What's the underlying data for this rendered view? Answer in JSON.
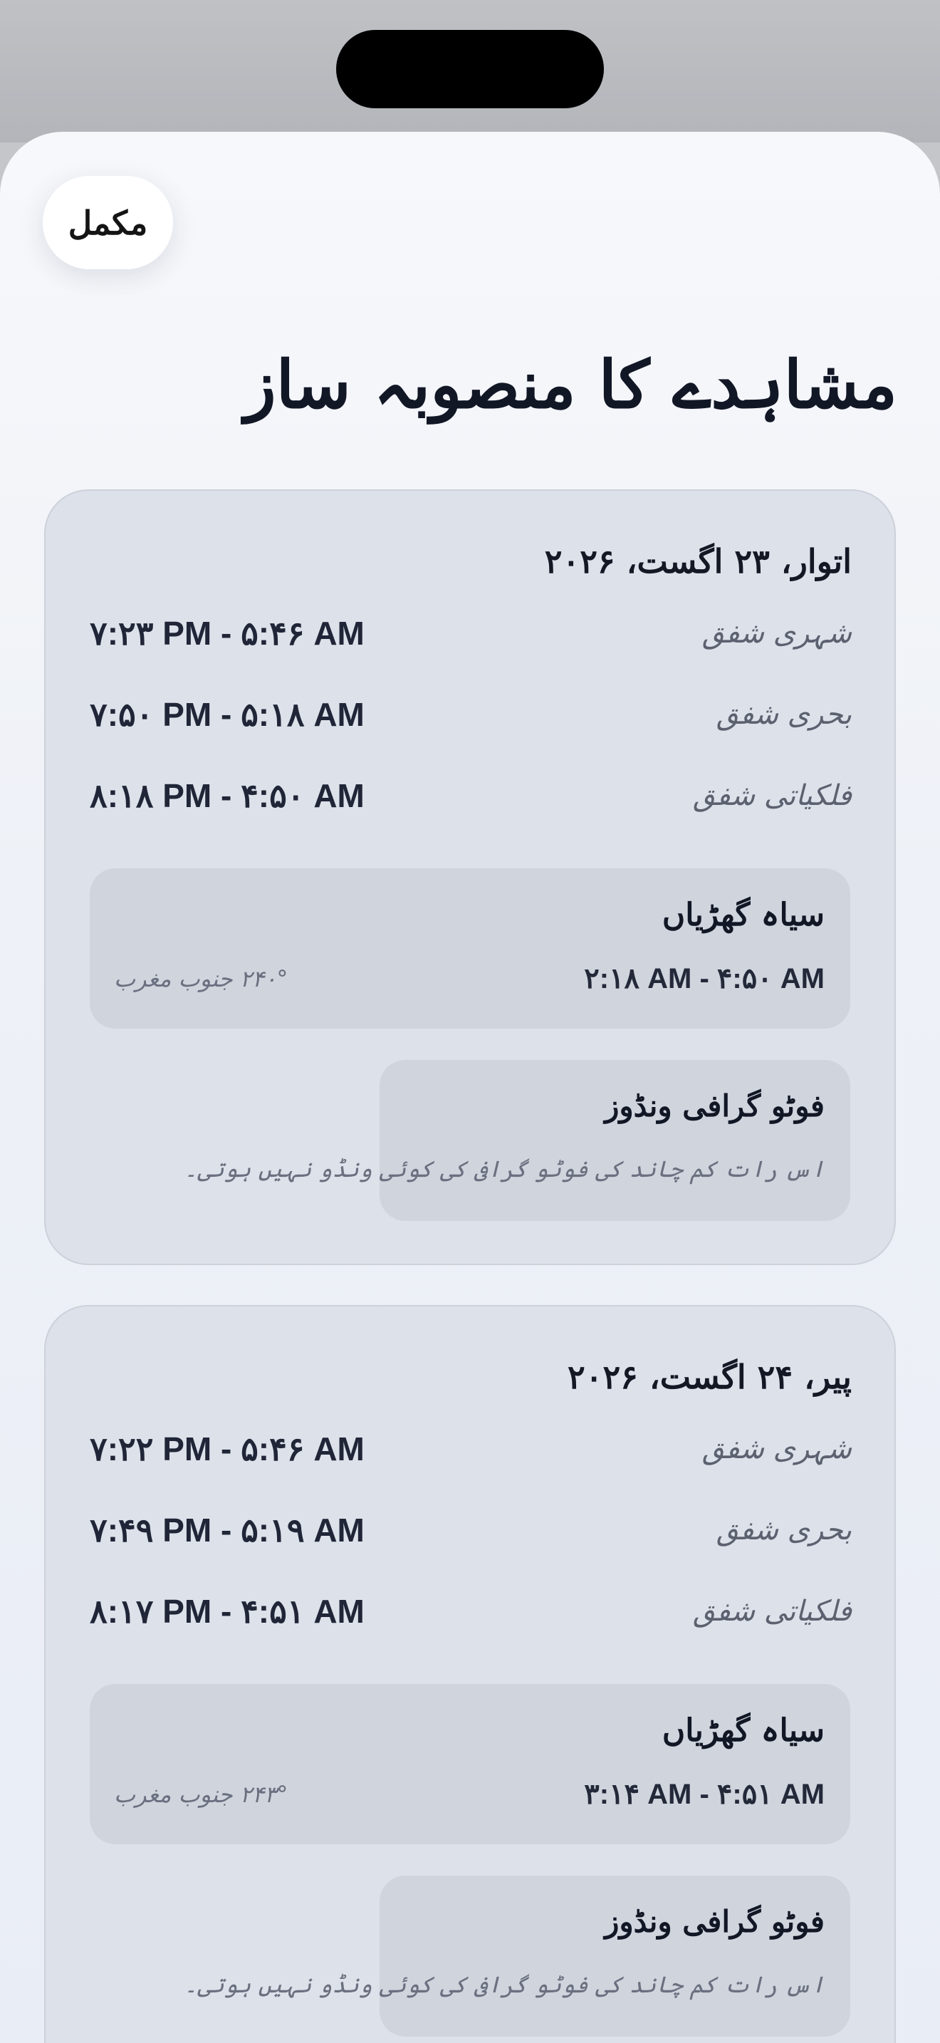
{
  "header": {
    "done_label": "مکمل",
    "title": "مشاہدے کا منصوبہ ساز"
  },
  "days": [
    {
      "date": "اتوار، ۲۳ اگست، ۲۰۲۶",
      "twilight": [
        {
          "label": "شہری شفق",
          "time": "۷:۲۳ PM - ۵:۴۶ AM"
        },
        {
          "label": "بحری شفق",
          "time": "۷:۵۰ PM - ۵:۱۸ AM"
        },
        {
          "label": "فلکیاتی شفق",
          "time": "۸:۱۸ PM - ۴:۵۰ AM"
        }
      ],
      "dark_hours": {
        "title": "سیاہ گھڑیاں",
        "time": "۲:۱۸ AM - ۴:۵۰ AM",
        "moon": "۲۴۰° جنوب مغرب"
      },
      "photo_window": {
        "title": "فوٹو گرافی ونڈوز",
        "note": "اس رات کم چاند کی فوٹو گرافی کی کوئی ونڈو نہیں ہوتی۔"
      }
    },
    {
      "date": "پیر، ۲۴ اگست، ۲۰۲۶",
      "twilight": [
        {
          "label": "شہری شفق",
          "time": "۷:۲۲ PM - ۵:۴۶ AM"
        },
        {
          "label": "بحری شفق",
          "time": "۷:۴۹ PM - ۵:۱۹ AM"
        },
        {
          "label": "فلکیاتی شفق",
          "time": "۸:۱۷ PM - ۴:۵۱ AM"
        }
      ],
      "dark_hours": {
        "title": "سیاہ گھڑیاں",
        "time": "۳:۱۴ AM - ۴:۵۱ AM",
        "moon": "۲۴۳° جنوب مغرب"
      },
      "photo_window": {
        "title": "فوٹو گرافی ونڈوز",
        "note": "اس رات کم چاند کی فوٹو گرافی کی کوئی ونڈو نہیں ہوتی۔"
      }
    }
  ]
}
